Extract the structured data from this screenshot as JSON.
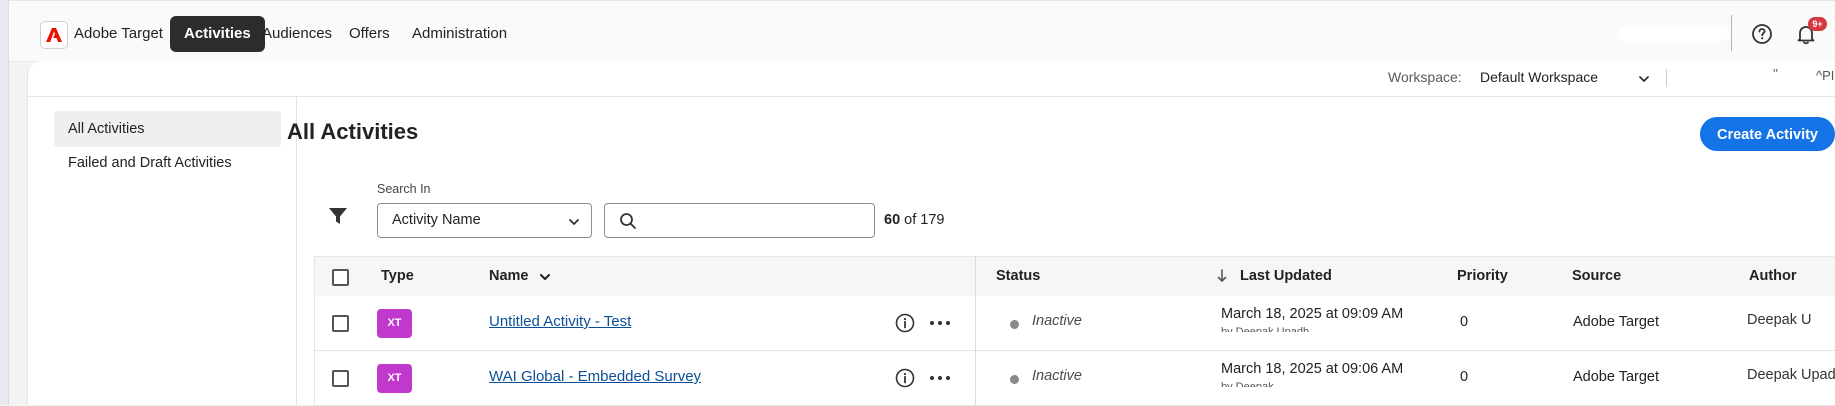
{
  "app": {
    "brand": "Adobe Target"
  },
  "nav": {
    "items": [
      {
        "label": "Activities",
        "active": true
      },
      {
        "label": "Audiences"
      },
      {
        "label": "Offers"
      },
      {
        "label": "Administration"
      }
    ],
    "notification_count": "9+"
  },
  "workspace": {
    "label": "Workspace:",
    "value": "Default Workspace",
    "frag1": "''",
    "frag2": "^PI"
  },
  "sidebar": {
    "items": [
      {
        "label": "All Activities",
        "active": true
      },
      {
        "label": "Failed and Draft Activities"
      }
    ]
  },
  "main": {
    "title": "All Activities",
    "create_button": "Create Activity"
  },
  "search": {
    "in_label": "Search In",
    "field_value": "Activity Name",
    "placeholder": "",
    "count_shown": "60",
    "count_total": "of 179"
  },
  "table": {
    "headers": {
      "type": "Type",
      "name": "Name",
      "status": "Status",
      "last_updated": "Last Updated",
      "priority": "Priority",
      "source": "Source",
      "author": "Author"
    },
    "rows": [
      {
        "type": "XT",
        "name": "Untitled Activity - Test",
        "status": "Inactive",
        "last_updated": "March 18, 2025 at 09:09 AM",
        "last_updated_sub": "by Deepak Upadh",
        "priority": "0",
        "source": "Adobe Target",
        "author": "Deepak U"
      },
      {
        "type": "XT",
        "name": "WAI Global - Embedded Survey",
        "status": "Inactive",
        "last_updated": "March 18, 2025 at 09:06 AM",
        "last_updated_sub": "by Deepak",
        "priority": "0",
        "source": "Adobe Target",
        "author": "Deepak Upad"
      }
    ]
  },
  "colors": {
    "accent": "#1473e6",
    "nav_active_bg": "#2c2c2c",
    "type_badge": "#c038cc",
    "badge_red": "#d7373f",
    "link": "#0b4f98"
  },
  "icons": {
    "logo": "adobe-logo-icon",
    "help": "help-icon",
    "bell": "bell-icon",
    "filter": "filter-icon",
    "search": "search-icon",
    "info": "info-icon",
    "more": "more-icon",
    "sort": "sort-arrow-icon"
  }
}
